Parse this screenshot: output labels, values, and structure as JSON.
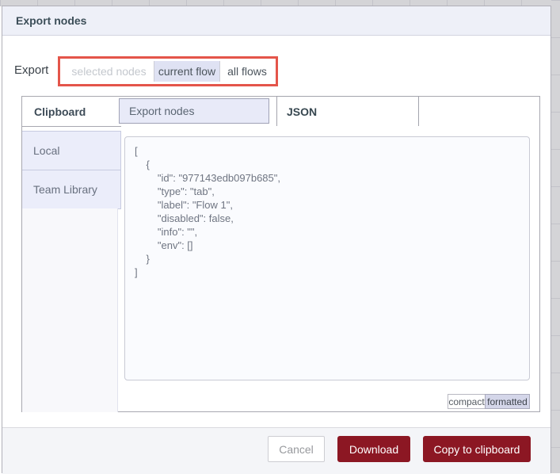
{
  "dialog": {
    "title": "Export nodes",
    "export_row": {
      "label": "Export",
      "options": [
        {
          "label": "selected nodes",
          "state": "disabled"
        },
        {
          "label": "current flow",
          "state": "selected"
        },
        {
          "label": "all flows",
          "state": "normal"
        }
      ]
    },
    "tabs": {
      "left_header": "Clipboard",
      "export_nodes_tab": "Export nodes",
      "json_tab": "JSON"
    },
    "sidebar": {
      "items": [
        {
          "label": "Local"
        },
        {
          "label": "Team Library"
        }
      ]
    },
    "json_panel": {
      "lines": [
        "[",
        "    {",
        "        \"id\": \"977143edb097b685\",",
        "        \"type\": \"tab\",",
        "        \"label\": \"Flow 1\",",
        "        \"disabled\": false,",
        "        \"info\": \"\",",
        "        \"env\": []",
        "    }",
        "]"
      ]
    },
    "format_toggle": {
      "compact_label": "compact",
      "formatted_label": "formatted",
      "selected": "formatted"
    },
    "footer": {
      "cancel_label": "Cancel",
      "download_label": "Download",
      "copy_label": "Copy to clipboard"
    }
  },
  "colors": {
    "primary_button": "#8c1723",
    "annotation_red": "#e4554a",
    "selected_segment": "#dfe2f3",
    "inactive_tab": "#e8eaf8",
    "header_bg": "#eef0f8",
    "footer_bg": "#f4f5f8"
  }
}
